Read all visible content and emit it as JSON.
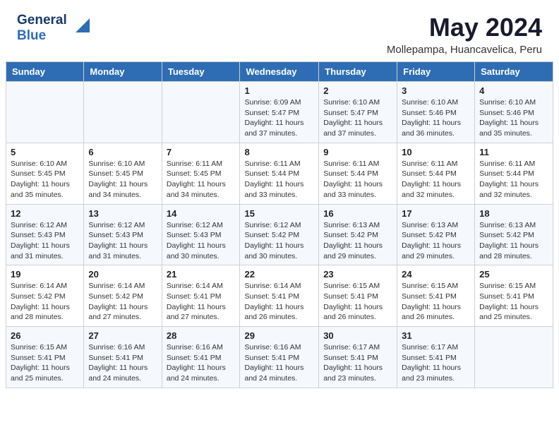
{
  "header": {
    "logo_line1": "General",
    "logo_line2": "Blue",
    "title": "May 2024",
    "subtitle": "Mollepampa, Huancavelica, Peru"
  },
  "days_of_week": [
    "Sunday",
    "Monday",
    "Tuesday",
    "Wednesday",
    "Thursday",
    "Friday",
    "Saturday"
  ],
  "weeks": [
    [
      {
        "day": "",
        "sunrise": "",
        "sunset": "",
        "daylight": ""
      },
      {
        "day": "",
        "sunrise": "",
        "sunset": "",
        "daylight": ""
      },
      {
        "day": "",
        "sunrise": "",
        "sunset": "",
        "daylight": ""
      },
      {
        "day": "1",
        "sunrise": "6:09 AM",
        "sunset": "5:47 PM",
        "daylight": "11 hours and 37 minutes."
      },
      {
        "day": "2",
        "sunrise": "6:10 AM",
        "sunset": "5:47 PM",
        "daylight": "11 hours and 37 minutes."
      },
      {
        "day": "3",
        "sunrise": "6:10 AM",
        "sunset": "5:46 PM",
        "daylight": "11 hours and 36 minutes."
      },
      {
        "day": "4",
        "sunrise": "6:10 AM",
        "sunset": "5:46 PM",
        "daylight": "11 hours and 35 minutes."
      }
    ],
    [
      {
        "day": "5",
        "sunrise": "6:10 AM",
        "sunset": "5:45 PM",
        "daylight": "11 hours and 35 minutes."
      },
      {
        "day": "6",
        "sunrise": "6:10 AM",
        "sunset": "5:45 PM",
        "daylight": "11 hours and 34 minutes."
      },
      {
        "day": "7",
        "sunrise": "6:11 AM",
        "sunset": "5:45 PM",
        "daylight": "11 hours and 34 minutes."
      },
      {
        "day": "8",
        "sunrise": "6:11 AM",
        "sunset": "5:44 PM",
        "daylight": "11 hours and 33 minutes."
      },
      {
        "day": "9",
        "sunrise": "6:11 AM",
        "sunset": "5:44 PM",
        "daylight": "11 hours and 33 minutes."
      },
      {
        "day": "10",
        "sunrise": "6:11 AM",
        "sunset": "5:44 PM",
        "daylight": "11 hours and 32 minutes."
      },
      {
        "day": "11",
        "sunrise": "6:11 AM",
        "sunset": "5:44 PM",
        "daylight": "11 hours and 32 minutes."
      }
    ],
    [
      {
        "day": "12",
        "sunrise": "6:12 AM",
        "sunset": "5:43 PM",
        "daylight": "11 hours and 31 minutes."
      },
      {
        "day": "13",
        "sunrise": "6:12 AM",
        "sunset": "5:43 PM",
        "daylight": "11 hours and 31 minutes."
      },
      {
        "day": "14",
        "sunrise": "6:12 AM",
        "sunset": "5:43 PM",
        "daylight": "11 hours and 30 minutes."
      },
      {
        "day": "15",
        "sunrise": "6:12 AM",
        "sunset": "5:42 PM",
        "daylight": "11 hours and 30 minutes."
      },
      {
        "day": "16",
        "sunrise": "6:13 AM",
        "sunset": "5:42 PM",
        "daylight": "11 hours and 29 minutes."
      },
      {
        "day": "17",
        "sunrise": "6:13 AM",
        "sunset": "5:42 PM",
        "daylight": "11 hours and 29 minutes."
      },
      {
        "day": "18",
        "sunrise": "6:13 AM",
        "sunset": "5:42 PM",
        "daylight": "11 hours and 28 minutes."
      }
    ],
    [
      {
        "day": "19",
        "sunrise": "6:14 AM",
        "sunset": "5:42 PM",
        "daylight": "11 hours and 28 minutes."
      },
      {
        "day": "20",
        "sunrise": "6:14 AM",
        "sunset": "5:42 PM",
        "daylight": "11 hours and 27 minutes."
      },
      {
        "day": "21",
        "sunrise": "6:14 AM",
        "sunset": "5:41 PM",
        "daylight": "11 hours and 27 minutes."
      },
      {
        "day": "22",
        "sunrise": "6:14 AM",
        "sunset": "5:41 PM",
        "daylight": "11 hours and 26 minutes."
      },
      {
        "day": "23",
        "sunrise": "6:15 AM",
        "sunset": "5:41 PM",
        "daylight": "11 hours and 26 minutes."
      },
      {
        "day": "24",
        "sunrise": "6:15 AM",
        "sunset": "5:41 PM",
        "daylight": "11 hours and 26 minutes."
      },
      {
        "day": "25",
        "sunrise": "6:15 AM",
        "sunset": "5:41 PM",
        "daylight": "11 hours and 25 minutes."
      }
    ],
    [
      {
        "day": "26",
        "sunrise": "6:15 AM",
        "sunset": "5:41 PM",
        "daylight": "11 hours and 25 minutes."
      },
      {
        "day": "27",
        "sunrise": "6:16 AM",
        "sunset": "5:41 PM",
        "daylight": "11 hours and 24 minutes."
      },
      {
        "day": "28",
        "sunrise": "6:16 AM",
        "sunset": "5:41 PM",
        "daylight": "11 hours and 24 minutes."
      },
      {
        "day": "29",
        "sunrise": "6:16 AM",
        "sunset": "5:41 PM",
        "daylight": "11 hours and 24 minutes."
      },
      {
        "day": "30",
        "sunrise": "6:17 AM",
        "sunset": "5:41 PM",
        "daylight": "11 hours and 23 minutes."
      },
      {
        "day": "31",
        "sunrise": "6:17 AM",
        "sunset": "5:41 PM",
        "daylight": "11 hours and 23 minutes."
      },
      {
        "day": "",
        "sunrise": "",
        "sunset": "",
        "daylight": ""
      }
    ]
  ],
  "labels": {
    "sunrise_prefix": "Sunrise: ",
    "sunset_prefix": "Sunset: ",
    "daylight_prefix": "Daylight: "
  }
}
